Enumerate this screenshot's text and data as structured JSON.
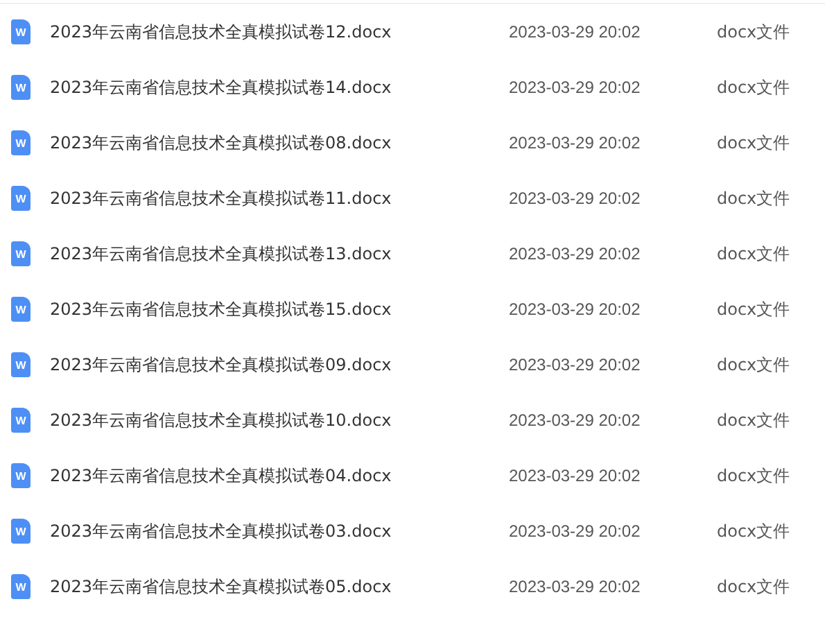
{
  "files": [
    {
      "icon_glyph": "W",
      "name": "2023年云南省信息技术全真模拟试卷12.docx",
      "modified": "2023-03-29 20:02",
      "type": "docx文件"
    },
    {
      "icon_glyph": "W",
      "name": "2023年云南省信息技术全真模拟试卷14.docx",
      "modified": "2023-03-29 20:02",
      "type": "docx文件"
    },
    {
      "icon_glyph": "W",
      "name": "2023年云南省信息技术全真模拟试卷08.docx",
      "modified": "2023-03-29 20:02",
      "type": "docx文件"
    },
    {
      "icon_glyph": "W",
      "name": "2023年云南省信息技术全真模拟试卷11.docx",
      "modified": "2023-03-29 20:02",
      "type": "docx文件"
    },
    {
      "icon_glyph": "W",
      "name": "2023年云南省信息技术全真模拟试卷13.docx",
      "modified": "2023-03-29 20:02",
      "type": "docx文件"
    },
    {
      "icon_glyph": "W",
      "name": "2023年云南省信息技术全真模拟试卷15.docx",
      "modified": "2023-03-29 20:02",
      "type": "docx文件"
    },
    {
      "icon_glyph": "W",
      "name": "2023年云南省信息技术全真模拟试卷09.docx",
      "modified": "2023-03-29 20:02",
      "type": "docx文件"
    },
    {
      "icon_glyph": "W",
      "name": "2023年云南省信息技术全真模拟试卷10.docx",
      "modified": "2023-03-29 20:02",
      "type": "docx文件"
    },
    {
      "icon_glyph": "W",
      "name": "2023年云南省信息技术全真模拟试卷04.docx",
      "modified": "2023-03-29 20:02",
      "type": "docx文件"
    },
    {
      "icon_glyph": "W",
      "name": "2023年云南省信息技术全真模拟试卷03.docx",
      "modified": "2023-03-29 20:02",
      "type": "docx文件"
    },
    {
      "icon_glyph": "W",
      "name": "2023年云南省信息技术全真模拟试卷05.docx",
      "modified": "2023-03-29 20:02",
      "type": "docx文件"
    }
  ]
}
